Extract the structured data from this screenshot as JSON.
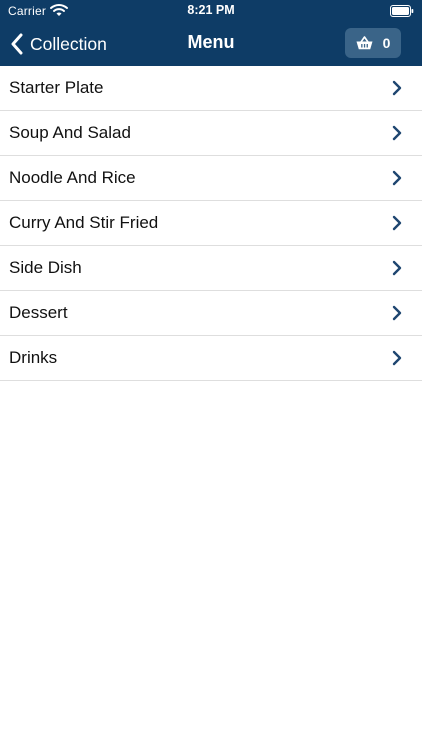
{
  "status_bar": {
    "carrier": "Carrier",
    "time": "8:21 PM"
  },
  "nav": {
    "back_label": "Collection",
    "title": "Menu",
    "cart_count": "0"
  },
  "menu": {
    "items": [
      {
        "label": "Starter Plate"
      },
      {
        "label": "Soup And Salad"
      },
      {
        "label": "Noodle And Rice"
      },
      {
        "label": "Curry And Stir Fried"
      },
      {
        "label": "Side Dish"
      },
      {
        "label": "Dessert"
      },
      {
        "label": "Drinks"
      }
    ]
  },
  "colors": {
    "header_bg": "#0e3c66",
    "cart_button_bg": "#3a6488",
    "chevron": "#1e4670",
    "divider": "#dedede"
  },
  "icons": {
    "back": "chevron-left-icon",
    "cart": "basket-icon",
    "row": "chevron-right-icon",
    "wifi": "wifi-icon",
    "battery": "battery-icon"
  }
}
